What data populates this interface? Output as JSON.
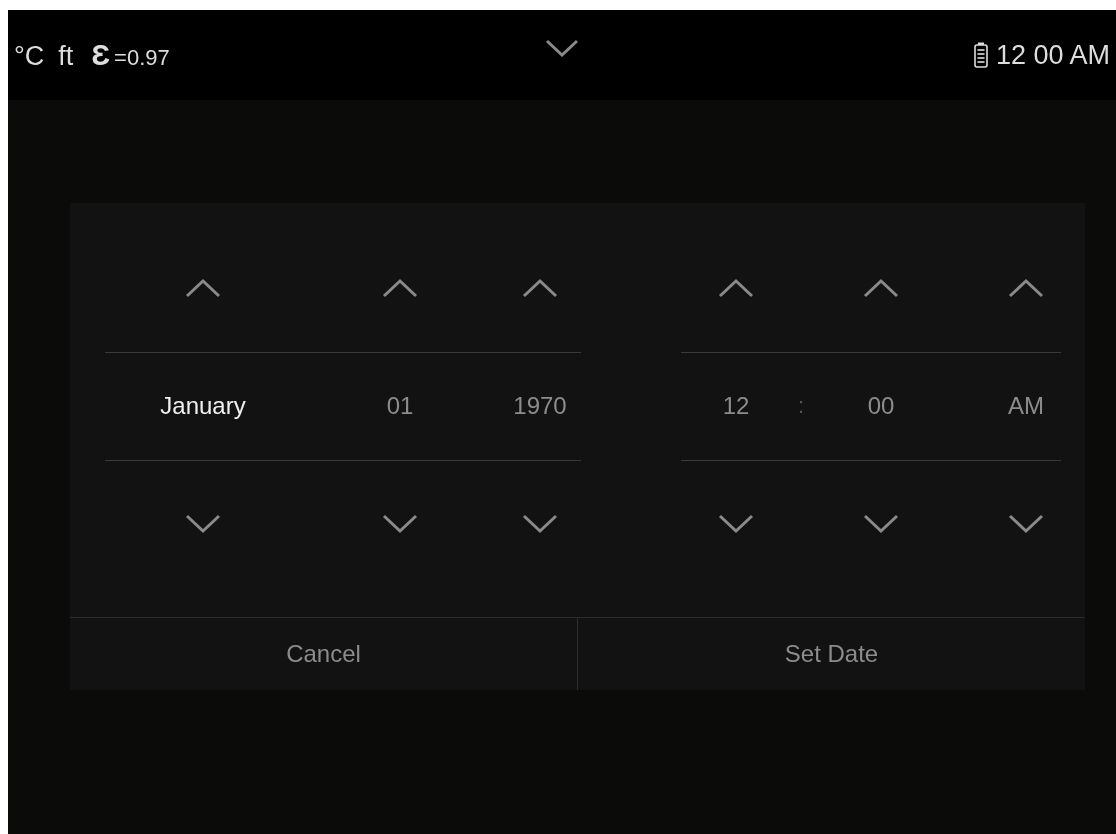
{
  "status_bar": {
    "temperature_unit": "°C",
    "distance_unit": "ft",
    "emissivity_symbol": "Ɛ",
    "emissivity": "=0.97",
    "time": "12 00 AM"
  },
  "date_picker": {
    "date_columns": [
      {
        "value": "January",
        "selected": true
      },
      {
        "value": "01",
        "selected": false
      },
      {
        "value": "1970",
        "selected": false
      }
    ],
    "time_columns": [
      {
        "value": "12",
        "selected": false
      },
      {
        "value": "00",
        "selected": false
      },
      {
        "value": "AM",
        "selected": false
      }
    ],
    "time_separator": ":",
    "buttons": [
      {
        "label": "Cancel"
      },
      {
        "label": "Set Date"
      }
    ]
  }
}
